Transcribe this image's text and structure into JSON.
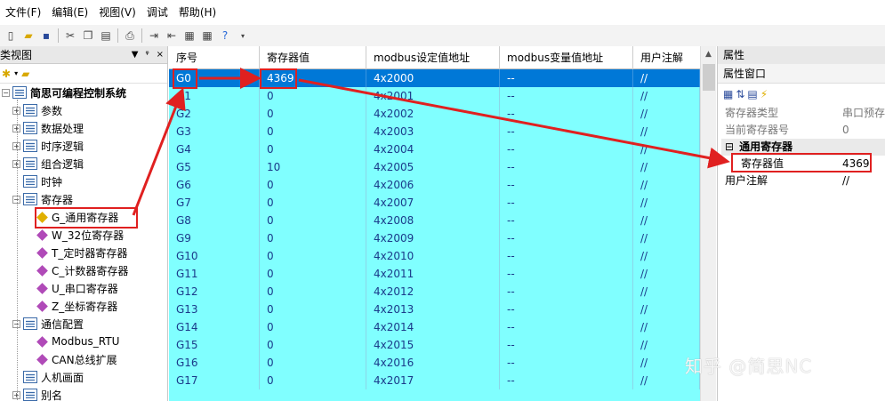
{
  "menu": [
    "文件(F)",
    "编辑(E)",
    "视图(V)",
    "调试",
    "帮助(H)"
  ],
  "left_panel": {
    "title": "类视图",
    "pin_label": "ᵠ",
    "close_label": "×",
    "root": "简思可编程控制系统",
    "nodes": [
      "参数",
      "数据处理",
      "时序逻辑",
      "组合逻辑",
      "时钟",
      "寄存器"
    ],
    "register_children": [
      "G_通用寄存器",
      "W_32位寄存器",
      "T_定时器寄存器",
      "C_计数器寄存器",
      "U_串口寄存器",
      "Z_坐标寄存器"
    ],
    "comm_node": "通信配置",
    "comm_children": [
      "Modbus_RTU",
      "CAN总线扩展"
    ],
    "tail_nodes": [
      "人机画面",
      "别名"
    ]
  },
  "grid": {
    "headers": [
      "序号",
      "寄存器值",
      "modbus设定值地址",
      "modbus变量值地址",
      "用户注解"
    ],
    "rows": [
      [
        "G0",
        "4369",
        "4x2000",
        "--",
        "//"
      ],
      [
        "G1",
        "0",
        "4x2001",
        "--",
        "//"
      ],
      [
        "G2",
        "0",
        "4x2002",
        "--",
        "//"
      ],
      [
        "G3",
        "0",
        "4x2003",
        "--",
        "//"
      ],
      [
        "G4",
        "0",
        "4x2004",
        "--",
        "//"
      ],
      [
        "G5",
        "10",
        "4x2005",
        "--",
        "//"
      ],
      [
        "G6",
        "0",
        "4x2006",
        "--",
        "//"
      ],
      [
        "G7",
        "0",
        "4x2007",
        "--",
        "//"
      ],
      [
        "G8",
        "0",
        "4x2008",
        "--",
        "//"
      ],
      [
        "G9",
        "0",
        "4x2009",
        "--",
        "//"
      ],
      [
        "G10",
        "0",
        "4x2010",
        "--",
        "//"
      ],
      [
        "G11",
        "0",
        "4x2011",
        "--",
        "//"
      ],
      [
        "G12",
        "0",
        "4x2012",
        "--",
        "//"
      ],
      [
        "G13",
        "0",
        "4x2013",
        "--",
        "//"
      ],
      [
        "G14",
        "0",
        "4x2014",
        "--",
        "//"
      ],
      [
        "G15",
        "0",
        "4x2015",
        "--",
        "//"
      ],
      [
        "G16",
        "0",
        "4x2016",
        "--",
        "//"
      ],
      [
        "G17",
        "0",
        "4x2017",
        "--",
        "//"
      ]
    ]
  },
  "properties": {
    "title": "属性",
    "window": "属性窗口",
    "rows_top": [
      {
        "key": "寄存器类型",
        "value": "串口预存"
      },
      {
        "key": "当前寄存器号",
        "value": "0"
      }
    ],
    "category": "通用寄存器",
    "rows_cat": [
      {
        "key": "寄存器值",
        "value": "4369"
      },
      {
        "key": "用户注解",
        "value": "//"
      }
    ]
  },
  "watermark": "知乎 @简思NC",
  "colors": {
    "grid_bg": "#80ffff",
    "selected_row": "#0078d7",
    "highlight": "#e02020"
  }
}
